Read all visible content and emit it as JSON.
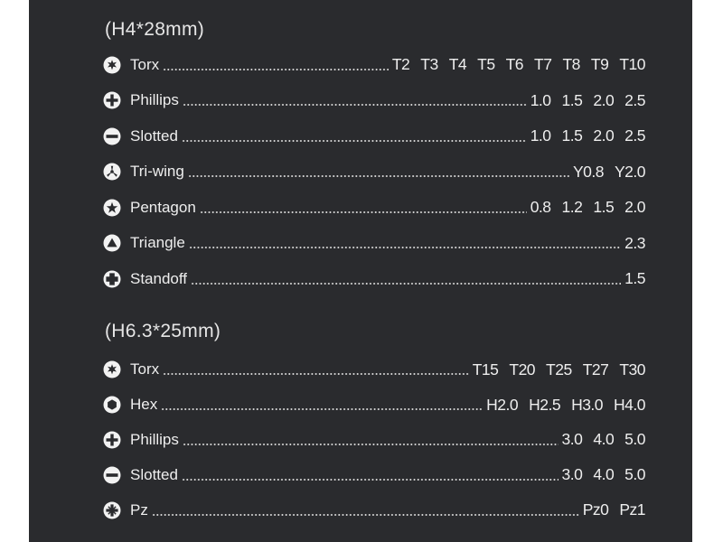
{
  "colors": {
    "panel_bg": "#2a2b2e",
    "text": "#eeeeee",
    "page_bg": "#ffffff"
  },
  "sections": [
    {
      "heading": "(H4*28mm)",
      "items": [
        {
          "icon": "torx-icon",
          "label": "Torx",
          "sizes": [
            "T2",
            "T3",
            "T4",
            "T5",
            "T6",
            "T7",
            "T8",
            "T9",
            "T10"
          ]
        },
        {
          "icon": "phillips-icon",
          "label": "Phillips",
          "sizes": [
            "1.0",
            "1.5",
            "2.0",
            "2.5"
          ]
        },
        {
          "icon": "slotted-icon",
          "label": "Slotted",
          "sizes": [
            "1.0",
            "1.5",
            "2.0",
            "2.5"
          ]
        },
        {
          "icon": "tri-wing-icon",
          "label": "Tri-wing",
          "sizes": [
            "Y0.8",
            "Y2.0"
          ]
        },
        {
          "icon": "pentagon-icon",
          "label": "Pentagon",
          "sizes": [
            "0.8",
            "1.2",
            "1.5",
            "2.0"
          ]
        },
        {
          "icon": "triangle-icon",
          "label": "Triangle",
          "sizes": [
            "2.3"
          ]
        },
        {
          "icon": "standoff-icon",
          "label": "Standoff",
          "sizes": [
            "1.5"
          ]
        }
      ]
    },
    {
      "heading": "(H6.3*25mm)",
      "items": [
        {
          "icon": "torx-icon",
          "label": "Torx",
          "sizes": [
            "T15",
            "T20",
            "T25",
            "T27",
            "T30"
          ]
        },
        {
          "icon": "hex-icon",
          "label": "Hex",
          "sizes": [
            "H2.0",
            "H2.5",
            "H3.0",
            "H4.0"
          ]
        },
        {
          "icon": "phillips-icon",
          "label": "Phillips",
          "sizes": [
            "3.0",
            "4.0",
            "5.0"
          ]
        },
        {
          "icon": "slotted-icon",
          "label": "Slotted",
          "sizes": [
            "3.0",
            "4.0",
            "5.0"
          ]
        },
        {
          "icon": "pozidriv-icon",
          "label": "Pz",
          "sizes": [
            "Pz0",
            "Pz1"
          ]
        }
      ]
    }
  ]
}
